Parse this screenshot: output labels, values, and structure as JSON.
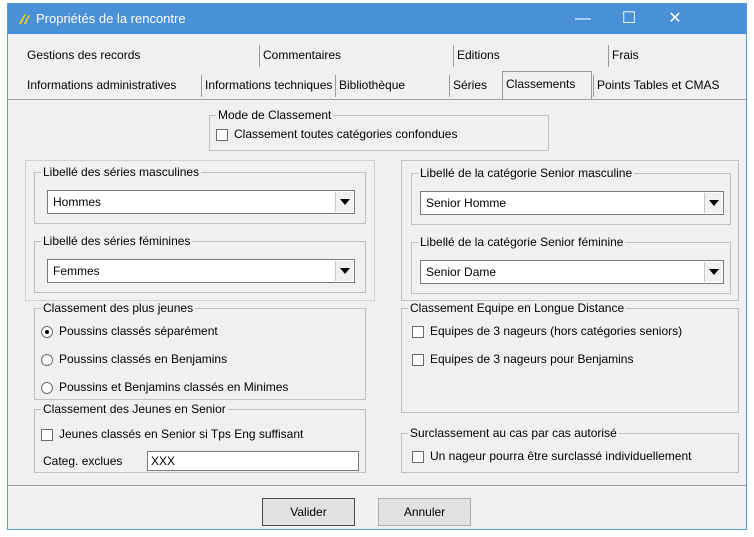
{
  "window": {
    "title": "Propriétés de la rencontre",
    "minimize_glyph": "—",
    "maximize_glyph": "☐",
    "close_glyph": "✕"
  },
  "tabs": {
    "row1": [
      "Gestions des records",
      "Commentaires",
      "Editions",
      "Frais"
    ],
    "row2": [
      "Informations administratives",
      "Informations techniques",
      "Bibliothèque",
      "Séries",
      "Classements",
      "Points Tables et CMAS"
    ],
    "active": "Classements"
  },
  "mode": {
    "title": "Mode de Classement",
    "checkbox_label": "Classement toutes catégories confondues"
  },
  "series_masc": {
    "title": "Libellé des séries masculines",
    "value": "Hommes"
  },
  "series_fem": {
    "title": "Libellé des séries féminines",
    "value": "Femmes"
  },
  "senior_masc": {
    "title": "Libellé de la catégorie Senior masculine",
    "value": "Senior Homme"
  },
  "senior_fem": {
    "title": "Libellé de la catégorie Senior  féminine",
    "value": "Senior Dame"
  },
  "plus_jeunes": {
    "title": "Classement des plus jeunes",
    "options": [
      "Poussins classés séparément",
      "Poussins classés en Benjamins",
      "Poussins et Benjamins classés en Minimes"
    ],
    "selected_index": 0
  },
  "equipe": {
    "title": "Classement Equipe en Longue Distance",
    "options": [
      "Equipes de 3 nageurs (hors catégories seniors)",
      "Equipes de 3 nageurs pour Benjamins"
    ]
  },
  "jeunes_senior": {
    "title": "Classement des Jeunes en Senior",
    "checkbox_label": "Jeunes classés en Senior si Tps Eng suffisant",
    "categ_label": "Categ. exclues",
    "categ_value": "XXX"
  },
  "surclassement": {
    "title": "Surclassement au cas par cas autorisé",
    "checkbox_label": "Un nageur pourra être surclassé individuellement"
  },
  "buttons": {
    "validate": "Valider",
    "cancel": "Annuler"
  },
  "colors": {
    "titlebar": "#4a90d9",
    "window_bg": "#f0f0f0"
  }
}
